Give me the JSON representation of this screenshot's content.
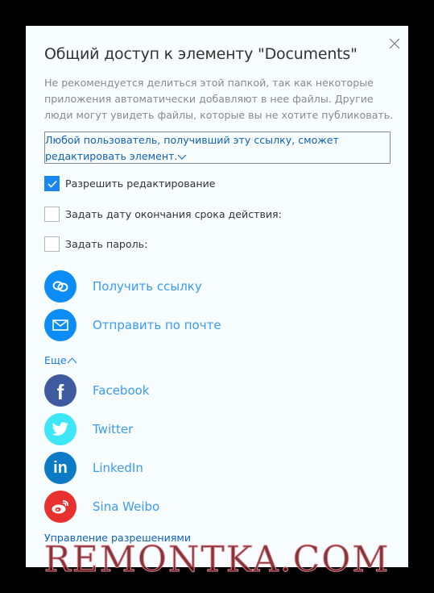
{
  "dialog": {
    "title": "Общий доступ к элементу \"Documents\"",
    "description": "Не рекомендуется делиться этой папкой, так как некоторые приложения автоматически добавляют в нее файлы. Другие люди могут увидеть файлы, которые вы не хотите публиковать.",
    "link_permission": "Любой пользователь, получивший эту ссылку, сможет редактировать элемент.",
    "options": [
      {
        "label": "Разрешить редактирование",
        "checked": true
      },
      {
        "label": "Задать дату окончания срока действия:",
        "checked": false
      },
      {
        "label": "Задать пароль:",
        "checked": false
      }
    ],
    "actions": [
      {
        "label": "Получить ссылку",
        "icon": "link-icon",
        "color": "#0b8df5"
      },
      {
        "label": "Отправить по почте",
        "icon": "mail-icon",
        "color": "#0b8df5"
      }
    ],
    "more_label": "Еще",
    "social": [
      {
        "label": "Facebook",
        "icon": "facebook-icon",
        "color": "#3f5b9f"
      },
      {
        "label": "Twitter",
        "icon": "twitter-icon",
        "color": "#3fe6f7"
      },
      {
        "label": "LinkedIn",
        "icon": "linkedin-icon",
        "color": "#0a7bc4"
      },
      {
        "label": "Sina Weibo",
        "icon": "weibo-icon",
        "color": "#e8302f"
      }
    ],
    "manage_label": "Управление разрешениями"
  },
  "watermark": "REMONTKA.COM"
}
